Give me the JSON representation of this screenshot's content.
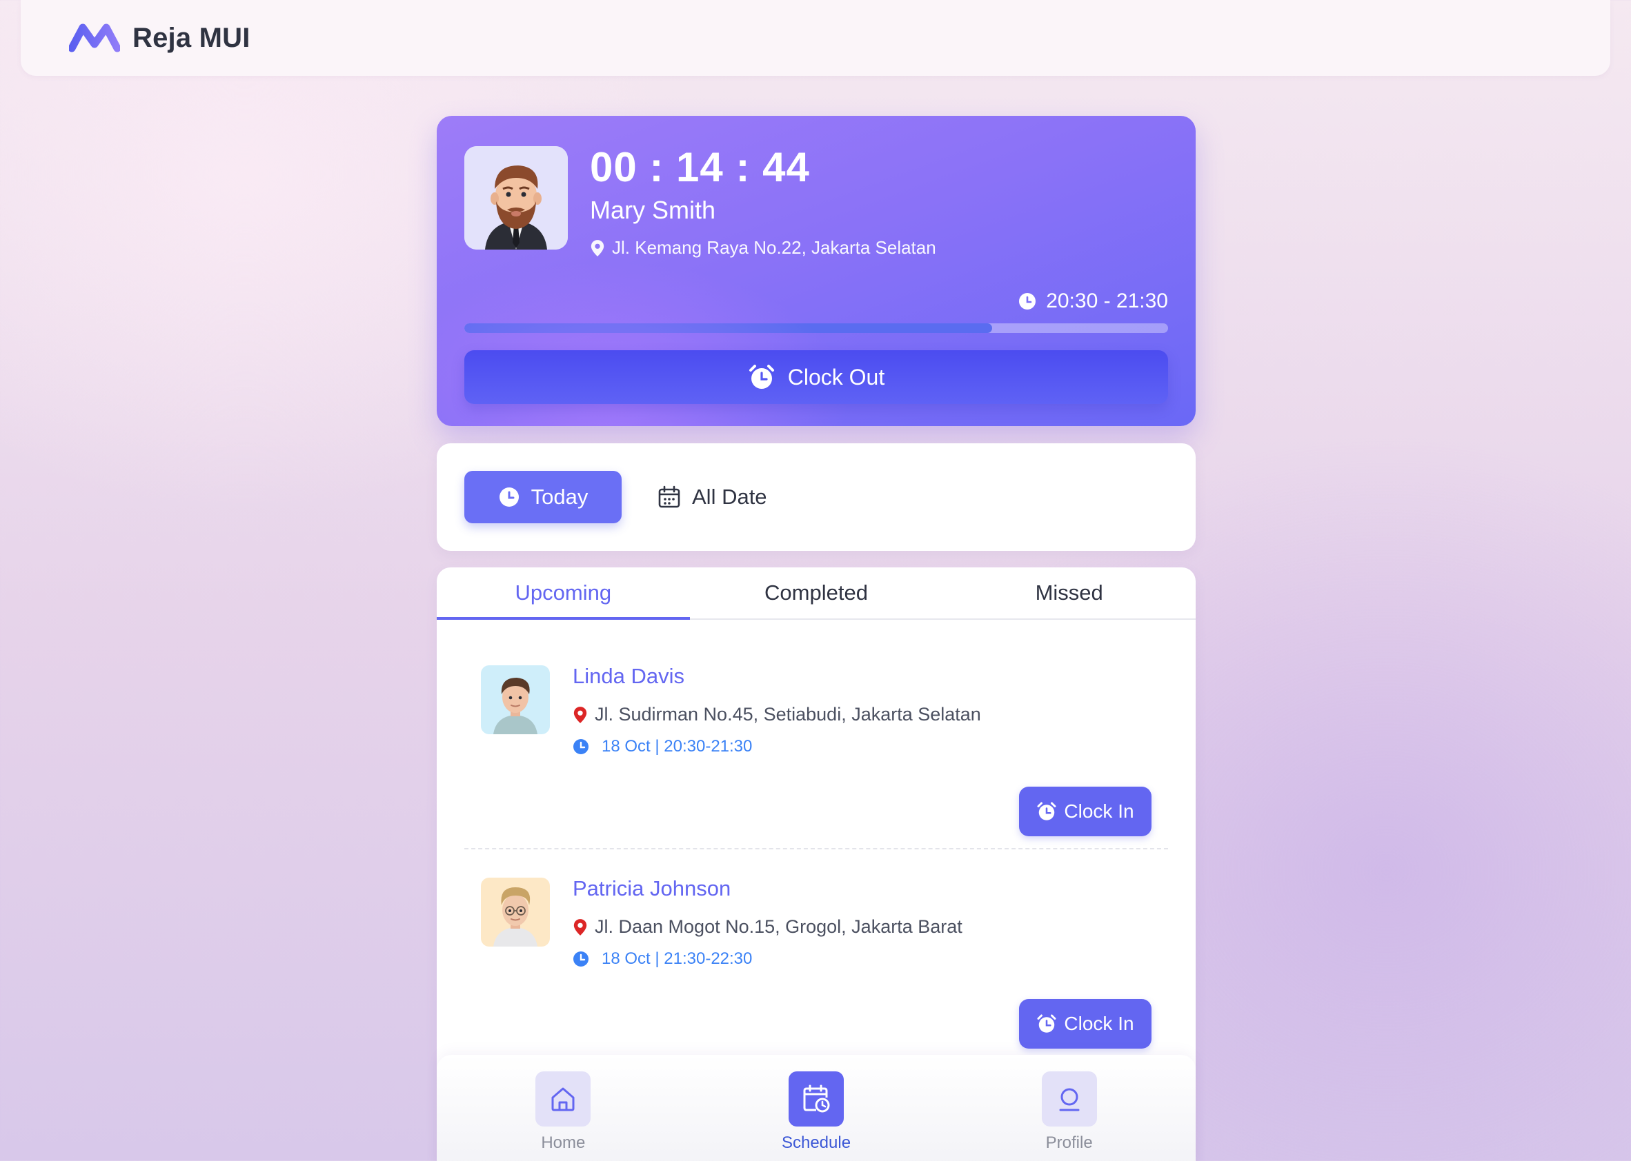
{
  "header": {
    "brand_name": "Reja MUI"
  },
  "hero": {
    "timer": "00 : 14 : 44",
    "name": "Mary Smith",
    "address": "Jl. Kemang Raya No.22, Jakarta Selatan",
    "shift": "20:30 - 21:30",
    "progress_percent": 75,
    "clock_out_label": "Clock Out"
  },
  "filter": {
    "today_label": "Today",
    "all_date_label": "All Date"
  },
  "tabs": [
    {
      "label": "Upcoming",
      "active": true
    },
    {
      "label": "Completed",
      "active": false
    },
    {
      "label": "Missed",
      "active": false
    }
  ],
  "schedule": [
    {
      "name": "Linda Davis",
      "address": "Jl. Sudirman No.45, Setiabudi, Jakarta Selatan",
      "time": "18 Oct | 20:30-21:30",
      "button": "Clock In"
    },
    {
      "name": "Patricia Johnson",
      "address": "Jl. Daan Mogot No.15, Grogol, Jakarta Barat",
      "time": "18 Oct | 21:30-22:30",
      "button": "Clock In"
    }
  ],
  "nav": [
    {
      "label": "Home",
      "icon": "home-icon",
      "active": false
    },
    {
      "label": "Schedule",
      "icon": "calendar-clock-icon",
      "active": true
    },
    {
      "label": "Profile",
      "icon": "profile-icon",
      "active": false
    }
  ],
  "colors": {
    "accent": "#6366f1",
    "time_blue": "#3b82f6",
    "pin_red": "#dc2626"
  }
}
